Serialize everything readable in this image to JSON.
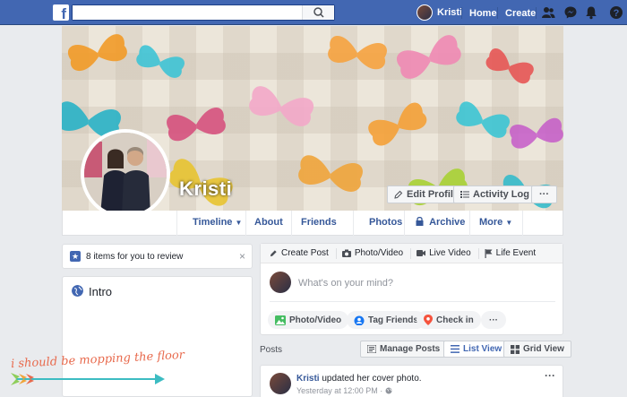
{
  "topbar": {
    "search": {
      "value": "",
      "placeholder": ""
    },
    "user_name": "Kristi",
    "links": [
      "Home",
      "Create"
    ],
    "icons": [
      "friends-icon",
      "messenger-icon",
      "notifications-icon",
      "help-icon"
    ]
  },
  "profile": {
    "name": "Kristi",
    "cover_buttons": {
      "edit_profile": "Edit Profile",
      "activity_log": "Activity Log",
      "more": "···"
    }
  },
  "timeline_nav": {
    "timeline": "Timeline",
    "about": "About",
    "friends": "Friends",
    "photos": "Photos",
    "archive": "Archive",
    "more": "More"
  },
  "left": {
    "review": "8 items for you to review",
    "close": "×",
    "intro_title": "Intro"
  },
  "composer": {
    "tabs": [
      "Create Post",
      "Photo/Video",
      "Live Video",
      "Life Event"
    ],
    "placeholder": "What's on your mind?",
    "actions": [
      "Photo/Video",
      "Tag Friends",
      "Check in"
    ],
    "more": "···"
  },
  "posts_header": {
    "label": "Posts",
    "manage_posts": "Manage Posts",
    "list_view": "List View",
    "grid_view": "Grid View"
  },
  "post": {
    "author": "Kristi",
    "action": "updated her cover photo.",
    "time": "Yesterday at 12:00 PM · ",
    "more": "···"
  },
  "watermark": "i should be mopping the floor",
  "colors": {
    "brand_blue": "#4267b2",
    "link_blue": "#365899",
    "page_bg": "#e9ebee"
  }
}
